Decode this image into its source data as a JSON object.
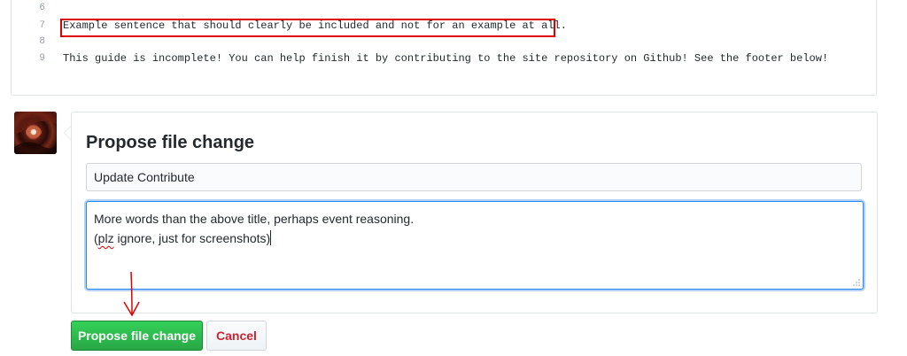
{
  "code": {
    "lines": [
      {
        "num": "6",
        "text": ""
      },
      {
        "num": "7",
        "text": "Example sentence that should clearly be included and not for an example at all."
      },
      {
        "num": "8",
        "text": ""
      },
      {
        "num": "9",
        "text": "This guide is incomplete! You can help finish it by contributing to the site repository on Github! See the footer below!"
      }
    ]
  },
  "propose": {
    "title": "Propose file change",
    "commit_title_value": "Update Contribute",
    "description_line1": "More words than the above title, perhaps event reasoning.",
    "description_line2_pre": "(",
    "description_line2_misspelled": "plz",
    "description_line2_post": " ignore, just for screenshots)",
    "submit_label": "Propose file change",
    "cancel_label": "Cancel"
  },
  "colors": {
    "annotation_red": "#e00000",
    "primary_green": "#28a745",
    "cancel_red": "#cb2431",
    "focus_blue": "#2188ff"
  }
}
